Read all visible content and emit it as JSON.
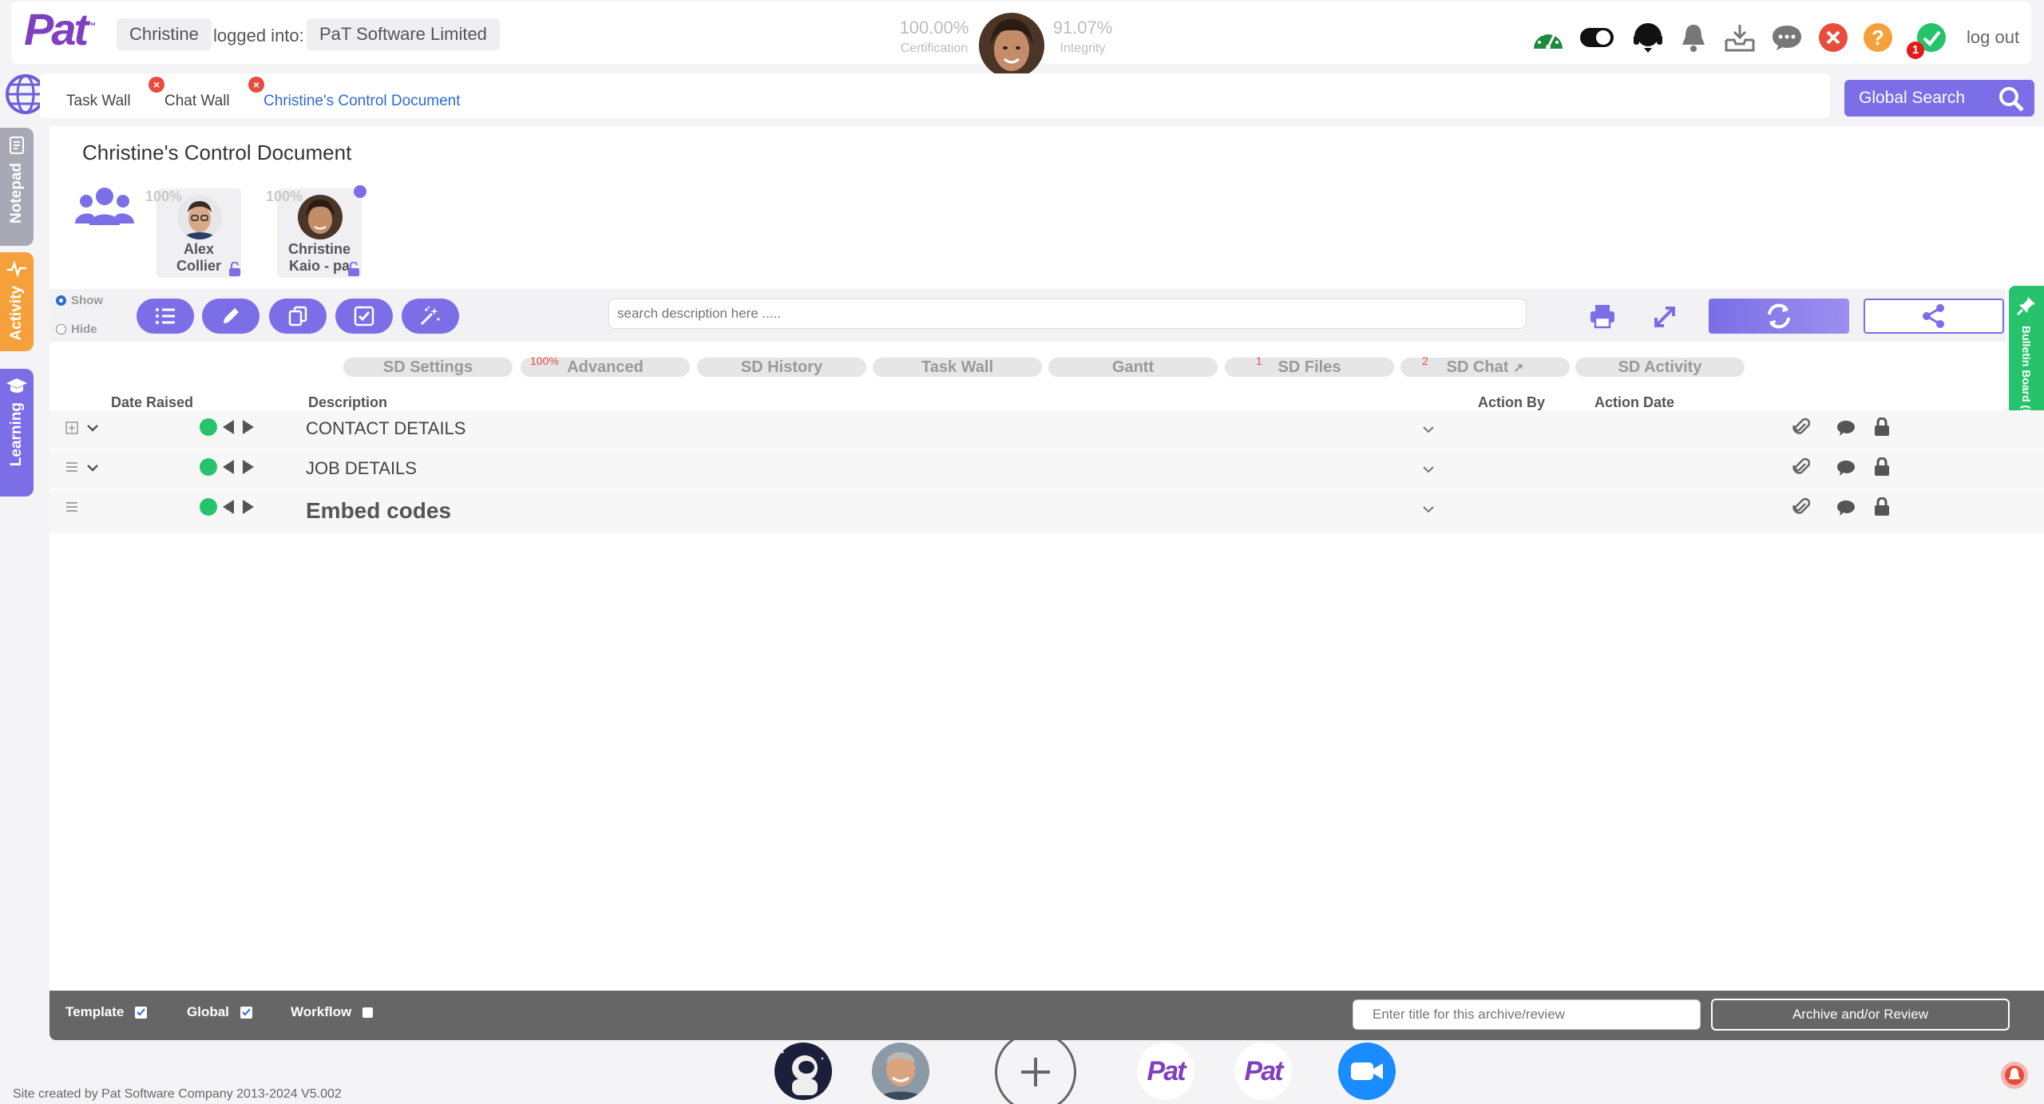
{
  "header": {
    "logo_text": "Pat",
    "logo_tm": "™",
    "user_name": "Christine",
    "logged_into_label": "logged into:",
    "company": "PaT Software Limited",
    "certification_value": "100.00%",
    "certification_label": "Certification",
    "integrity_value": "91.07%",
    "integrity_label": "Integrity",
    "task_badge_count": "1",
    "logout_label": "log out",
    "icons": [
      "dashboard-gauge-icon",
      "toggle-icon",
      "support-headset-icon",
      "bell-icon",
      "inbox-download-icon",
      "chat-icon",
      "close-circle-icon",
      "help-icon",
      "check-circle-icon"
    ]
  },
  "tabs": [
    {
      "label": "Task Wall",
      "closable": false,
      "active": false
    },
    {
      "label": "Chat Wall",
      "closable": true,
      "active": false
    },
    {
      "label": "Christine's Control Document",
      "closable": true,
      "active": true
    }
  ],
  "global_search": {
    "label": "Global Search"
  },
  "left_rail": [
    {
      "label": "Notepad",
      "color": "#a9a9b5"
    },
    {
      "label": "Activity",
      "color": "#f5a03a"
    },
    {
      "label": "Learning",
      "color": "#7b6ee6"
    }
  ],
  "document": {
    "title": "Christine's Control Document",
    "members": [
      {
        "percent": "100%",
        "name_line1": "Alex",
        "name_line2": "Collier"
      },
      {
        "percent": "100%",
        "name_line1": "Christine",
        "name_line2": "Kaio - pa"
      }
    ]
  },
  "toolbar": {
    "show_label": "Show",
    "hide_label": "Hide",
    "selected": "Show",
    "search_placeholder": "search description here .....",
    "buttons": [
      "list-icon",
      "pencil-icon",
      "copy-icon",
      "checkbox-icon",
      "magic-wand-icon"
    ]
  },
  "sub_tabs": [
    {
      "label": "SD Settings",
      "badge": ""
    },
    {
      "label": "Advanced",
      "badge": "100%"
    },
    {
      "label": "SD History",
      "badge": ""
    },
    {
      "label": "Task Wall",
      "badge": ""
    },
    {
      "label": "Gantt",
      "badge": ""
    },
    {
      "label": "SD Files",
      "badge": "1"
    },
    {
      "label": "SD Chat",
      "badge": "2"
    },
    {
      "label": "SD Activity",
      "badge": ""
    }
  ],
  "table": {
    "columns": {
      "date_raised": "Date Raised",
      "description": "Description",
      "action_by": "Action By",
      "action_date": "Action Date"
    },
    "rows": [
      {
        "description": "CONTACT DETAILS"
      },
      {
        "description": "JOB DETAILS"
      },
      {
        "description": "Embed codes"
      }
    ]
  },
  "footer_bar": {
    "template_label": "Template",
    "template_checked": true,
    "global_label": "Global",
    "global_checked": true,
    "workflow_label": "Workflow",
    "workflow_checked": false,
    "archive_placeholder": "Enter title for this archive/review",
    "archive_button": "Archive and/or Review"
  },
  "bulletin_board": {
    "label": "Bulletin Board (BB)"
  },
  "credit": "Site created by Pat Software Company 2013-2024 V5.002",
  "colors": {
    "accent": "#7b6ee6",
    "green": "#27c26c",
    "danger": "#e74c3c",
    "warning": "#f5a03a"
  }
}
